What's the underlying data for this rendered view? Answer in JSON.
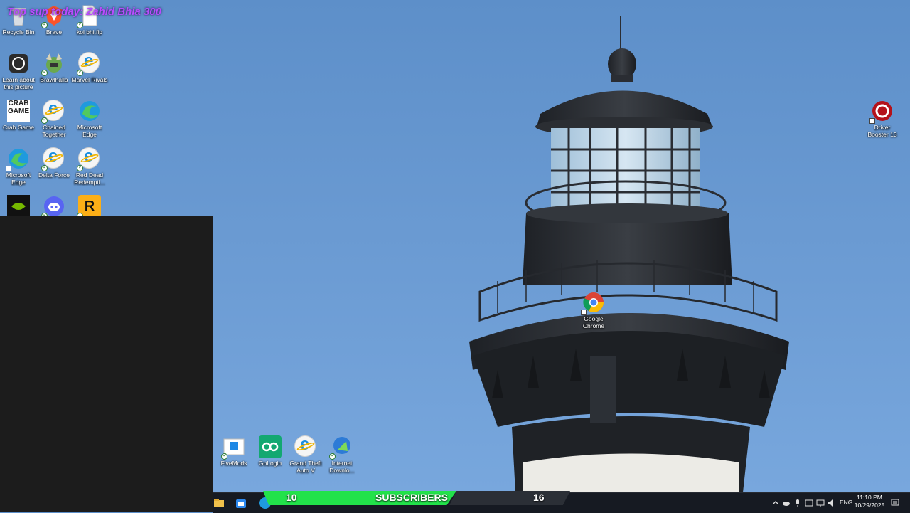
{
  "overlay": {
    "top_sup_text": "Top sup today: Zahid Bhia 300"
  },
  "desktop_icons": [
    {
      "id": "recycle-bin",
      "label": "Recycle Bin"
    },
    {
      "id": "brave",
      "label": "Brave"
    },
    {
      "id": "koi-bhi-fip",
      "label": "koi bhi.fip"
    },
    {
      "id": "learn-about-picture",
      "label": "Learn about this picture"
    },
    {
      "id": "brawlhalla",
      "label": "Brawlhalla"
    },
    {
      "id": "marvel-rivals",
      "label": "Marvel Rivals"
    },
    {
      "id": "crab-game",
      "label": "Crab Game",
      "art_text": "CRAB GAME"
    },
    {
      "id": "chained-together",
      "label": "Chained Together"
    },
    {
      "id": "microsoft-edge-1",
      "label": "Microsoft Edge"
    },
    {
      "id": "microsoft-edge-2",
      "label": "Microsoft Edge"
    },
    {
      "id": "delta-force",
      "label": "Delta Force"
    },
    {
      "id": "red-dead",
      "label": "Red Dead Redempti..."
    },
    {
      "id": "nvidia",
      "label": ""
    },
    {
      "id": "discord",
      "label": ""
    },
    {
      "id": "rockstar",
      "label": "",
      "art_text": "R"
    },
    {
      "id": "google-chrome",
      "label": "Google Chrome"
    },
    {
      "id": "driver-booster",
      "label": "Driver Booster 13"
    },
    {
      "id": "fivemods",
      "label": "FiveMods"
    },
    {
      "id": "gologin",
      "label": "GoLogin"
    },
    {
      "id": "gta-v",
      "label": "Grand Theft Auto V"
    },
    {
      "id": "idm",
      "label": "Internet Downlo..."
    }
  ],
  "subscriber_bar": {
    "left_count": "10",
    "label": "SUBSCRIBERS",
    "right_count": "16",
    "progress_fraction": 0.63
  },
  "tray": {
    "language": "ENG",
    "time": "11:10 PM",
    "date": "10/29/2025"
  },
  "colors": {
    "sub_green": "#22e24a",
    "taskbar": "#161a22",
    "overlay_purple": "#b94cff"
  }
}
